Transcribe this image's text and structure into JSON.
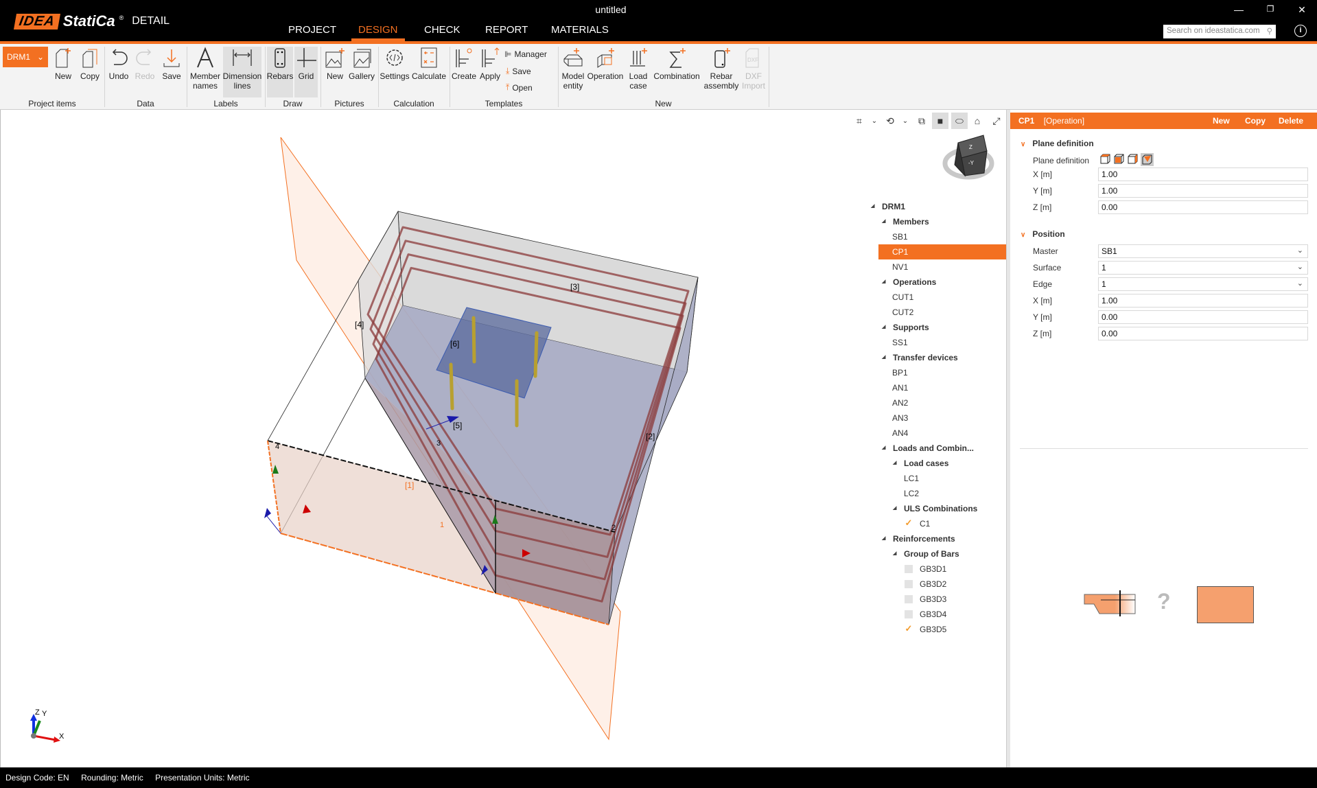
{
  "app": {
    "logo_brand": "IDEA",
    "logo_name": "StatiCa",
    "logo_product": "DETAIL",
    "window_title": "untitled",
    "search_placeholder": "Search on ideastatica.com"
  },
  "tabs": [
    {
      "label": "PROJECT"
    },
    {
      "label": "DESIGN",
      "active": true
    },
    {
      "label": "CHECK"
    },
    {
      "label": "REPORT"
    },
    {
      "label": "MATERIALS"
    }
  ],
  "ribbon": {
    "project_selector": "DRM1",
    "groups": {
      "project_items": "Project items",
      "data": "Data",
      "labels": "Labels",
      "draw": "Draw",
      "pictures": "Pictures",
      "calculation": "Calculation",
      "templates": "Templates",
      "new": "New"
    },
    "buttons": {
      "new": "New",
      "copy": "Copy",
      "undo": "Undo",
      "redo": "Redo",
      "save": "Save",
      "member_names_1": "Member",
      "member_names_2": "names",
      "dimension_lines_1": "Dimension",
      "dimension_lines_2": "lines",
      "rebars": "Rebars",
      "grid": "Grid",
      "picture_new": "New",
      "gallery": "Gallery",
      "settings": "Settings",
      "calculate": "Calculate",
      "create": "Create",
      "apply": "Apply",
      "manager": "Manager",
      "tpl_save": "Save",
      "open": "Open",
      "model_entity_1": "Model",
      "model_entity_2": "entity",
      "operation": "Operation",
      "load_case_1": "Load",
      "load_case_2": "case",
      "combination": "Combination",
      "rebar_assembly_1": "Rebar",
      "rebar_assembly_2": "assembly",
      "dxf_import_1": "DXF",
      "dxf_import_2": "Import"
    }
  },
  "viewport": {
    "labels": {
      "l3": "[3]",
      "l4": "[4]",
      "l6": "[6]",
      "l5": "[5]",
      "l2": "[2]",
      "l1": "[1]",
      "e1": "1",
      "e2": "2",
      "e3": "3",
      "e4": "4"
    },
    "axes": {
      "x": "X",
      "y": "Y",
      "z": "Z"
    },
    "navcube": {
      "top": "Z",
      "front": "-Y"
    }
  },
  "tree": {
    "root": "DRM1",
    "members": {
      "label": "Members",
      "items": [
        "SB1",
        "CP1",
        "NV1"
      ],
      "selected": "CP1"
    },
    "operations": {
      "label": "Operations",
      "items": [
        "CUT1",
        "CUT2"
      ]
    },
    "supports": {
      "label": "Supports",
      "items": [
        "SS1"
      ]
    },
    "transfer": {
      "label": "Transfer devices",
      "items": [
        "BP1",
        "AN1",
        "AN2",
        "AN3",
        "AN4"
      ]
    },
    "loads": {
      "label": "Loads and Combin...",
      "load_cases": {
        "label": "Load cases",
        "items": [
          "LC1",
          "LC2"
        ]
      },
      "uls": {
        "label": "ULS Combinations",
        "items": [
          {
            "name": "C1",
            "checked": true
          }
        ]
      }
    },
    "reinforcements": {
      "label": "Reinforcements",
      "group": {
        "label": "Group of Bars",
        "items": [
          {
            "name": "GB3D1",
            "checked": false
          },
          {
            "name": "GB3D2",
            "checked": false
          },
          {
            "name": "GB3D3",
            "checked": false
          },
          {
            "name": "GB3D4",
            "checked": false
          },
          {
            "name": "GB3D5",
            "checked": true
          }
        ]
      }
    }
  },
  "panel": {
    "title": "CP1",
    "subtitle": "[Operation]",
    "new": "New",
    "copy": "Copy",
    "delete": "Delete",
    "plane_section": "Plane definition",
    "plane_label": "Plane definition",
    "plane_x_label": "X [m]",
    "plane_x": "1.00",
    "plane_y_label": "Y [m]",
    "plane_y": "1.00",
    "plane_z_label": "Z [m]",
    "plane_z": "0.00",
    "position_section": "Position",
    "master_label": "Master",
    "master": "SB1",
    "surface_label": "Surface",
    "surface": "1",
    "edge_label": "Edge",
    "edge": "1",
    "pos_x_label": "X [m]",
    "pos_x": "1.00",
    "pos_y_label": "Y [m]",
    "pos_y": "0.00",
    "pos_z_label": "Z [m]",
    "pos_z": "0.00",
    "preview_unknown": "?"
  },
  "status": {
    "design_code": "Design Code: EN",
    "rounding": "Rounding: Metric",
    "units": "Presentation Units: Metric"
  },
  "colors": {
    "accent": "#f37021",
    "titlebar": "#000000",
    "rebar": "#8b3a3a",
    "plate": "#5a6a9c"
  }
}
